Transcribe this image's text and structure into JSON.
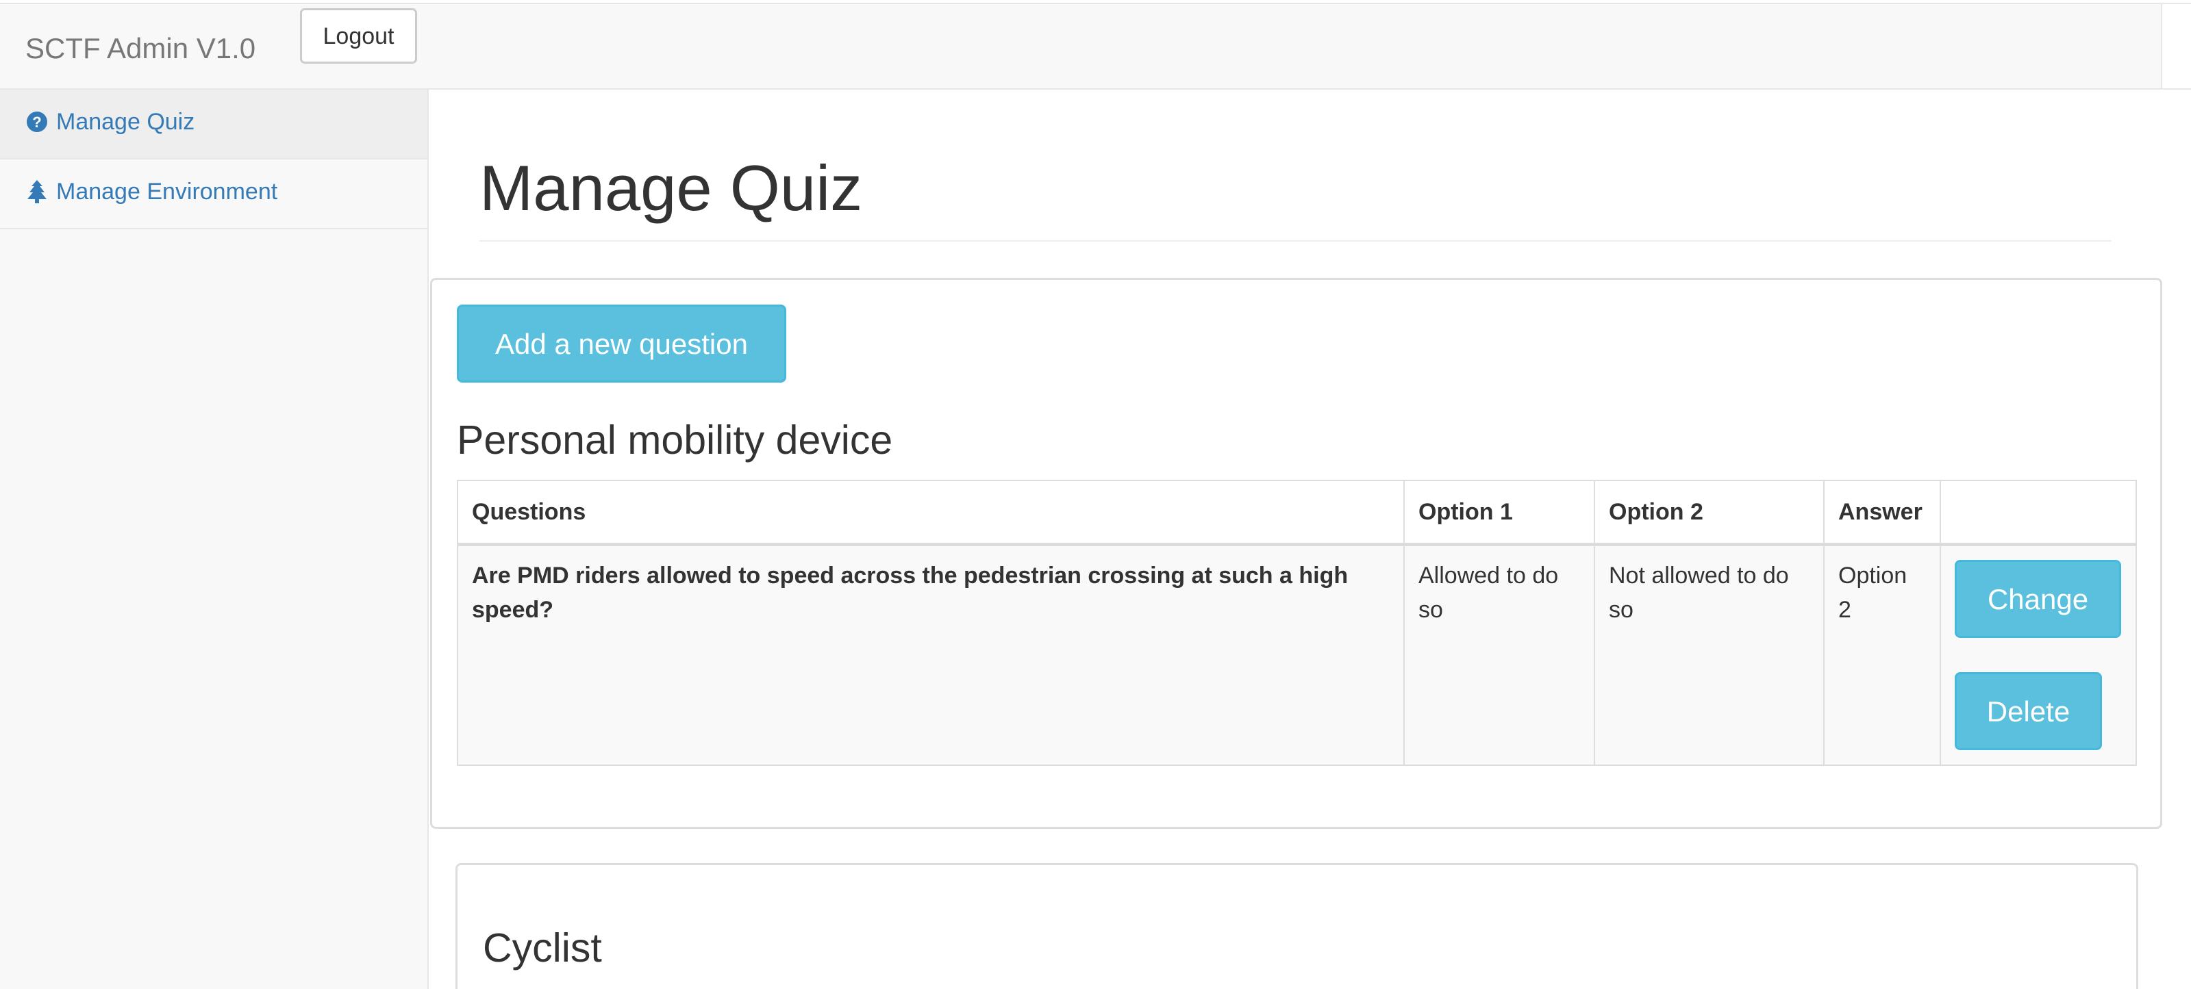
{
  "navbar": {
    "brand": "SCTF Admin V1.0",
    "logout_label": "Logout"
  },
  "sidebar": {
    "items": [
      {
        "label": "Manage Quiz",
        "icon": "question-circle-icon",
        "active": true
      },
      {
        "label": "Manage Environment",
        "icon": "tree-icon",
        "active": false
      }
    ]
  },
  "main": {
    "page_title": "Manage Quiz",
    "add_button_label": "Add a new question",
    "sections": [
      {
        "title": "Personal mobility device",
        "table": {
          "columns": [
            "Questions",
            "Option 1",
            "Option 2",
            "Answer",
            ""
          ],
          "rows": [
            {
              "question": "Are PMD riders allowed to speed across the pedestrian crossing at such a high speed?",
              "option1": "Allowed to do so",
              "option2": "Not allowed to do so",
              "answer": "Option 2",
              "change_label": "Change",
              "delete_label": "Delete"
            }
          ]
        }
      },
      {
        "title": "Cyclist"
      }
    ]
  },
  "colors": {
    "link": "#337ab7",
    "info_button": "#5bc0de",
    "info_button_border": "#46b8da",
    "navbar_bg": "#f8f8f8",
    "brand_text": "#777777"
  }
}
